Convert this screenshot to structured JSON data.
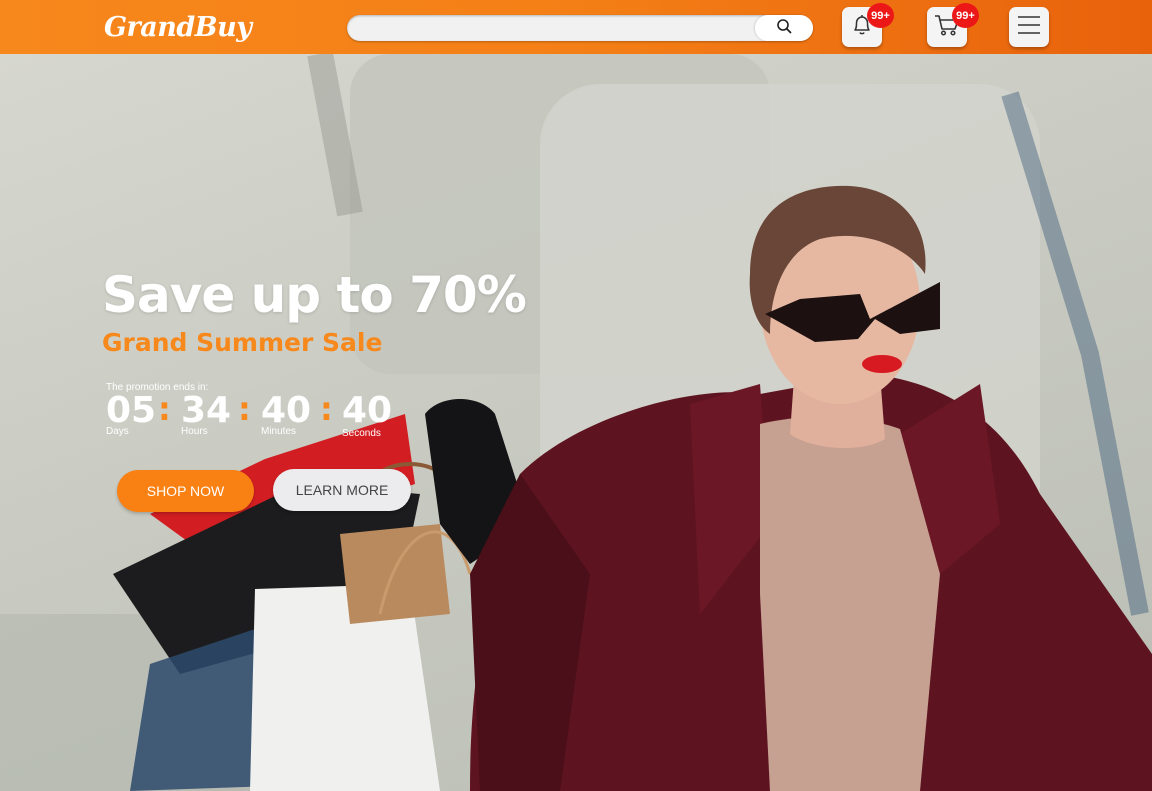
{
  "header": {
    "logo": "GrandBuy",
    "search": {
      "placeholder": "",
      "value": ""
    },
    "notifications_badge": "99+",
    "cart_badge": "99+"
  },
  "hero": {
    "headline": "Save up to 70%",
    "subline": "Grand Summer Sale",
    "promo_label": "The promotion ends in:",
    "countdown": {
      "days": "05",
      "days_label": "Days",
      "hours": "34",
      "hours_label": "Hours",
      "minutes": "40",
      "minutes_label": "Minutes",
      "seconds": "40",
      "seconds_label": "Seconds",
      "separator": ":"
    },
    "shop_button": "SHOP NOW",
    "learn_button": "LEARN MORE"
  },
  "colors": {
    "brand_orange": "#f7881c",
    "badge_red": "#ec1818",
    "coat": "#5e1420"
  },
  "icons": [
    "search-icon",
    "bell-icon",
    "cart-icon",
    "menu-icon"
  ]
}
